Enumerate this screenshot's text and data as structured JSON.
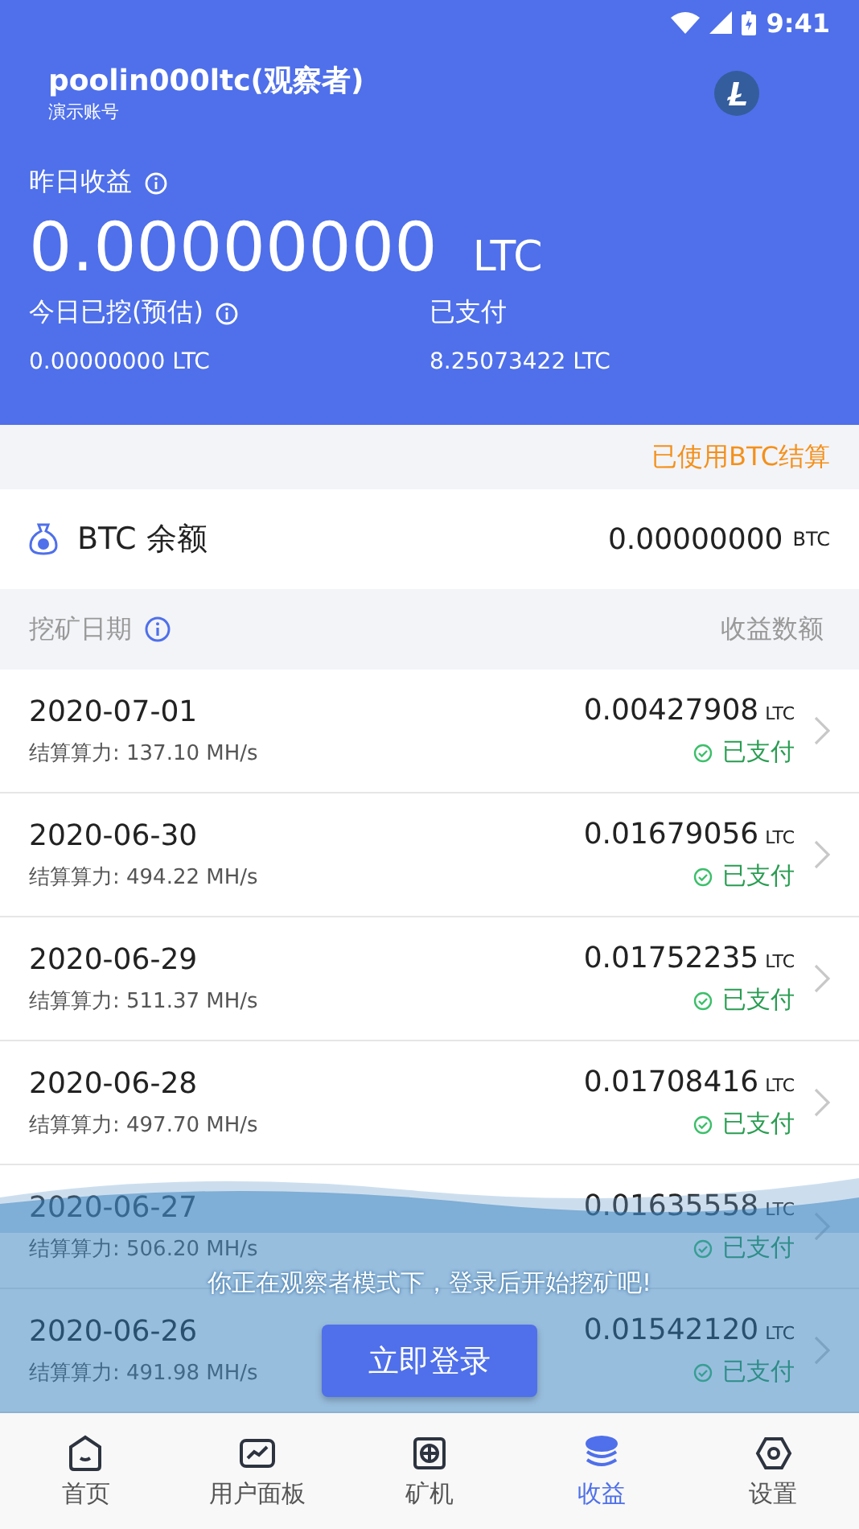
{
  "status_bar": {
    "time": "9:41"
  },
  "account": {
    "name": "poolin000ltc(观察者)",
    "subtitle": "演示账号"
  },
  "yesterday": {
    "label": "昨日收益",
    "amount": "0.00000000",
    "unit": "LTC"
  },
  "stats": [
    {
      "label": "今日已挖(预估)",
      "info": true,
      "value": "0.00000000 LTC"
    },
    {
      "label": "已支付",
      "info": false,
      "value": "8.25073422 LTC"
    }
  ],
  "settlement_note": "已使用BTC结算",
  "balance": {
    "label": "BTC 余额",
    "amount": "0.00000000",
    "unit": "BTC"
  },
  "list_header": {
    "date": "挖矿日期",
    "amount": "收益数额"
  },
  "rows": [
    {
      "date": "2020-07-01",
      "hashrate": "结算算力: 137.10 MH/s",
      "amount": "0.00427908",
      "unit": "LTC",
      "status": "已支付",
      "paid": true
    },
    {
      "date": "2020-06-30",
      "hashrate": "结算算力: 494.22 MH/s",
      "amount": "0.01679056",
      "unit": "LTC",
      "status": "已支付",
      "paid": true
    },
    {
      "date": "2020-06-29",
      "hashrate": "结算算力: 511.37 MH/s",
      "amount": "0.01752235",
      "unit": "LTC",
      "status": "已支付",
      "paid": true
    },
    {
      "date": "2020-06-28",
      "hashrate": "结算算力: 497.70 MH/s",
      "amount": "0.01708416",
      "unit": "LTC",
      "status": "已支付",
      "paid": true
    },
    {
      "date": "2020-06-27",
      "hashrate": "结算算力: 506.20 MH/s",
      "amount": "0.01635558",
      "unit": "LTC",
      "status": "已支付",
      "paid": true
    },
    {
      "date": "2020-06-26",
      "hashrate": "结算算力: 491.98 MH/s",
      "amount": "0.01542120",
      "unit": "LTC",
      "status": "已支付",
      "paid": true
    }
  ],
  "banner": {
    "message": "你正在观察者模式下，登录后开始挖矿吧!",
    "button": "立即登录"
  },
  "tabs": [
    {
      "label": "首页",
      "kind": "home",
      "selected": false
    },
    {
      "label": "用户面板",
      "kind": "dashboard",
      "selected": false
    },
    {
      "label": "矿机",
      "kind": "miner",
      "selected": false
    },
    {
      "label": "收益",
      "kind": "earnings",
      "selected": true
    },
    {
      "label": "设置",
      "kind": "settings",
      "selected": false
    }
  ]
}
